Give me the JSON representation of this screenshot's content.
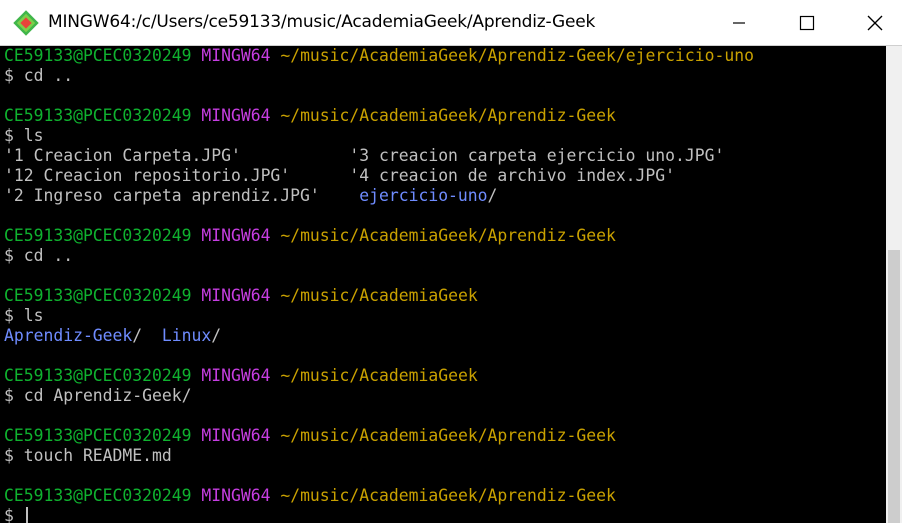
{
  "window": {
    "title": "MINGW64:/c/Users/ce59133/music/AcademiaGeek/Aprendiz-Geek",
    "icon": "git-bash-diamond-icon",
    "buttons": [
      "minimize",
      "maximize",
      "close"
    ]
  },
  "colors": {
    "user": "#0fb22f",
    "system": "#c63ee1",
    "path": "#c9a100",
    "directory": "#6f8cff",
    "text": "#c0c0c0",
    "background": "#000000"
  },
  "terminal": {
    "lines": [
      [
        {
          "t": "CE59133@PCEC0320249",
          "c": "user"
        },
        {
          "t": " ",
          "c": "text"
        },
        {
          "t": "MINGW64",
          "c": "sys"
        },
        {
          "t": " ",
          "c": "text"
        },
        {
          "t": "~/music/AcademiaGeek/Aprendiz-Geek/ejercicio-uno",
          "c": "path"
        }
      ],
      [
        {
          "t": "$ cd ..",
          "c": "text"
        }
      ],
      [],
      [
        {
          "t": "CE59133@PCEC0320249",
          "c": "user"
        },
        {
          "t": " ",
          "c": "text"
        },
        {
          "t": "MINGW64",
          "c": "sys"
        },
        {
          "t": " ",
          "c": "text"
        },
        {
          "t": "~/music/AcademiaGeek/Aprendiz-Geek",
          "c": "path"
        }
      ],
      [
        {
          "t": "$ ls",
          "c": "text"
        }
      ],
      [
        {
          "t": "'1 Creacion Carpeta.JPG'           '3 creacion carpeta ejercicio uno.JPG'",
          "c": "text"
        }
      ],
      [
        {
          "t": "'12 Creacion repositorio.JPG'      '4 creacion de archivo index.JPG'",
          "c": "text"
        }
      ],
      [
        {
          "t": "'2 Ingreso carpeta aprendiz.JPG'    ",
          "c": "text"
        },
        {
          "t": "ejercicio-uno",
          "c": "dir"
        },
        {
          "t": "/",
          "c": "text"
        }
      ],
      [],
      [
        {
          "t": "CE59133@PCEC0320249",
          "c": "user"
        },
        {
          "t": " ",
          "c": "text"
        },
        {
          "t": "MINGW64",
          "c": "sys"
        },
        {
          "t": " ",
          "c": "text"
        },
        {
          "t": "~/music/AcademiaGeek/Aprendiz-Geek",
          "c": "path"
        }
      ],
      [
        {
          "t": "$ cd ..",
          "c": "text"
        }
      ],
      [],
      [
        {
          "t": "CE59133@PCEC0320249",
          "c": "user"
        },
        {
          "t": " ",
          "c": "text"
        },
        {
          "t": "MINGW64",
          "c": "sys"
        },
        {
          "t": " ",
          "c": "text"
        },
        {
          "t": "~/music/AcademiaGeek",
          "c": "path"
        }
      ],
      [
        {
          "t": "$ ls",
          "c": "text"
        }
      ],
      [
        {
          "t": "Aprendiz-Geek",
          "c": "dir"
        },
        {
          "t": "/  ",
          "c": "text"
        },
        {
          "t": "Linux",
          "c": "dir"
        },
        {
          "t": "/",
          "c": "text"
        }
      ],
      [],
      [
        {
          "t": "CE59133@PCEC0320249",
          "c": "user"
        },
        {
          "t": " ",
          "c": "text"
        },
        {
          "t": "MINGW64",
          "c": "sys"
        },
        {
          "t": " ",
          "c": "text"
        },
        {
          "t": "~/music/AcademiaGeek",
          "c": "path"
        }
      ],
      [
        {
          "t": "$ cd Aprendiz-Geek/",
          "c": "text"
        }
      ],
      [],
      [
        {
          "t": "CE59133@PCEC0320249",
          "c": "user"
        },
        {
          "t": " ",
          "c": "text"
        },
        {
          "t": "MINGW64",
          "c": "sys"
        },
        {
          "t": " ",
          "c": "text"
        },
        {
          "t": "~/music/AcademiaGeek/Aprendiz-Geek",
          "c": "path"
        }
      ],
      [
        {
          "t": "$ touch README.md",
          "c": "text"
        }
      ],
      [],
      [
        {
          "t": "CE59133@PCEC0320249",
          "c": "user"
        },
        {
          "t": " ",
          "c": "text"
        },
        {
          "t": "MINGW64",
          "c": "sys"
        },
        {
          "t": " ",
          "c": "text"
        },
        {
          "t": "~/music/AcademiaGeek/Aprendiz-Geek",
          "c": "path"
        }
      ],
      [
        {
          "t": "$ ",
          "c": "text"
        }
      ]
    ]
  }
}
